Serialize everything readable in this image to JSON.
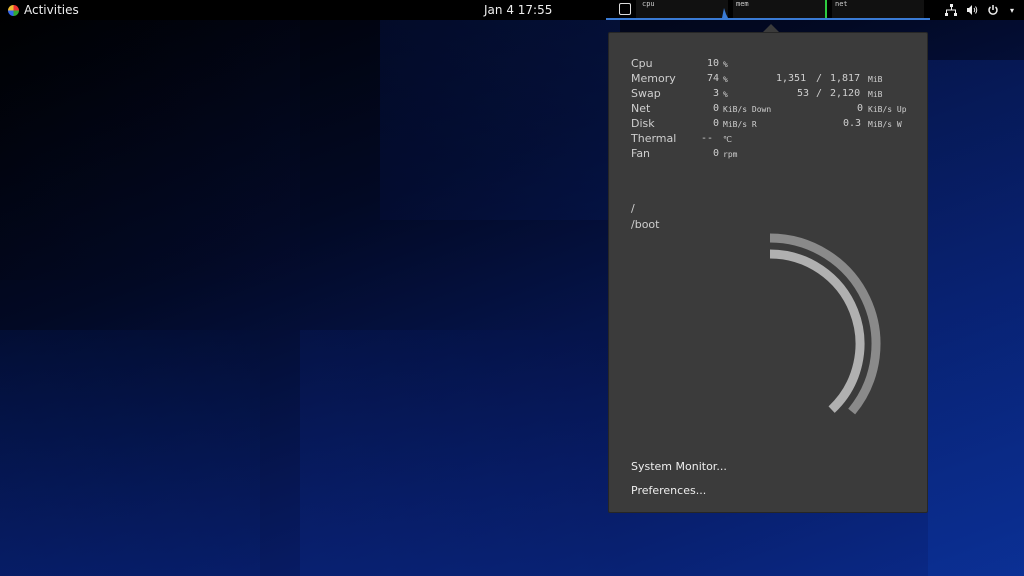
{
  "topbar": {
    "activities_label": "Activities",
    "clock": "Jan 4  17:55",
    "monitor": {
      "cpu_label": "cpu",
      "mem_label": "mem",
      "net_label": "net"
    }
  },
  "stats": {
    "cpu": {
      "label": "Cpu",
      "value": "10",
      "unit": "%"
    },
    "memory": {
      "label": "Memory",
      "value": "74",
      "unit": "%",
      "used": "1,351",
      "sep": "/",
      "total": "1,817",
      "size_unit": "MiB"
    },
    "swap": {
      "label": "Swap",
      "value": "3",
      "unit": "%",
      "used": "53",
      "sep": "/",
      "total": "2,120",
      "size_unit": "MiB"
    },
    "net": {
      "label": "Net",
      "down": "0",
      "down_unit": "KiB/s Down",
      "up": "0",
      "up_unit": "KiB/s Up"
    },
    "disk": {
      "label": "Disk",
      "read": "0",
      "read_unit": "MiB/s R",
      "write": "0.3",
      "write_unit": "MiB/s W"
    },
    "thermal": {
      "label": "Thermal",
      "value": "--",
      "unit": "℃"
    },
    "fan": {
      "label": "Fan",
      "value": "0",
      "unit": "rpm"
    }
  },
  "disks": [
    {
      "label": "/",
      "usage": 0.36
    },
    {
      "label": "/boot",
      "usage": 0.38
    }
  ],
  "menu": {
    "system_monitor": "System Monitor...",
    "preferences": "Preferences..."
  },
  "colors": {
    "accent": "#3a7bd5",
    "popup_bg": "#3b3b3b",
    "arc": "#9a9a9a"
  }
}
